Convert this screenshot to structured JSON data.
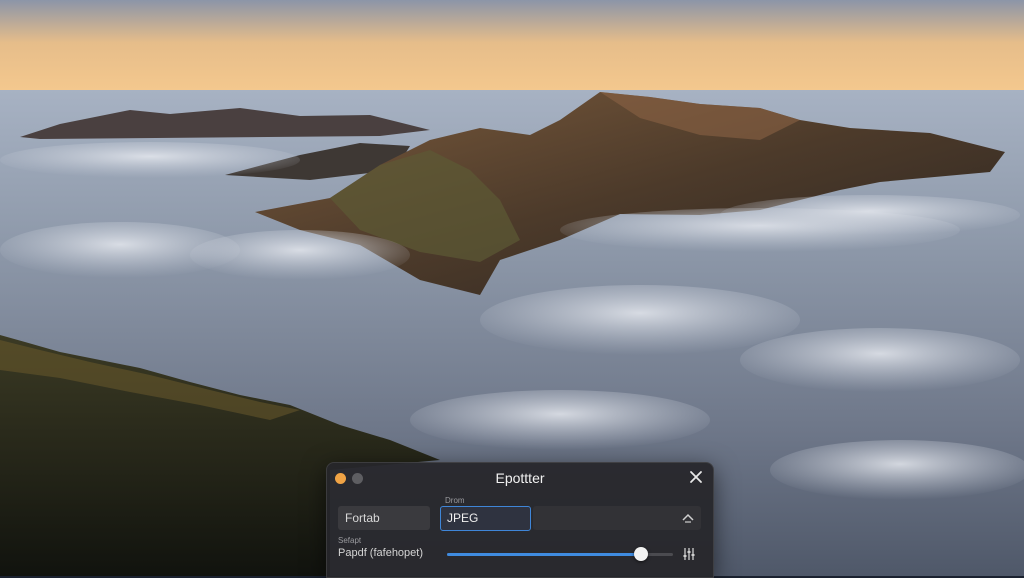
{
  "dialog": {
    "title": "Epottter",
    "field_caption": "Drom",
    "format_label": "Fortab",
    "format_value": "JPEG",
    "small_caption": "Sefapt",
    "quality_label": "Papdf (fafehopet)",
    "quality_level": 0.86,
    "icons": {
      "window_dot_1": "orange-dot-icon",
      "window_dot_2": "gray-dot-icon",
      "close": "close-icon",
      "dropdown": "chevron-dropdown-icon",
      "settings": "sliders-icon"
    },
    "colors": {
      "accent": "#3f86d8",
      "dialog_bg": "#26262a",
      "traffic_orange": "#f0a345"
    }
  }
}
